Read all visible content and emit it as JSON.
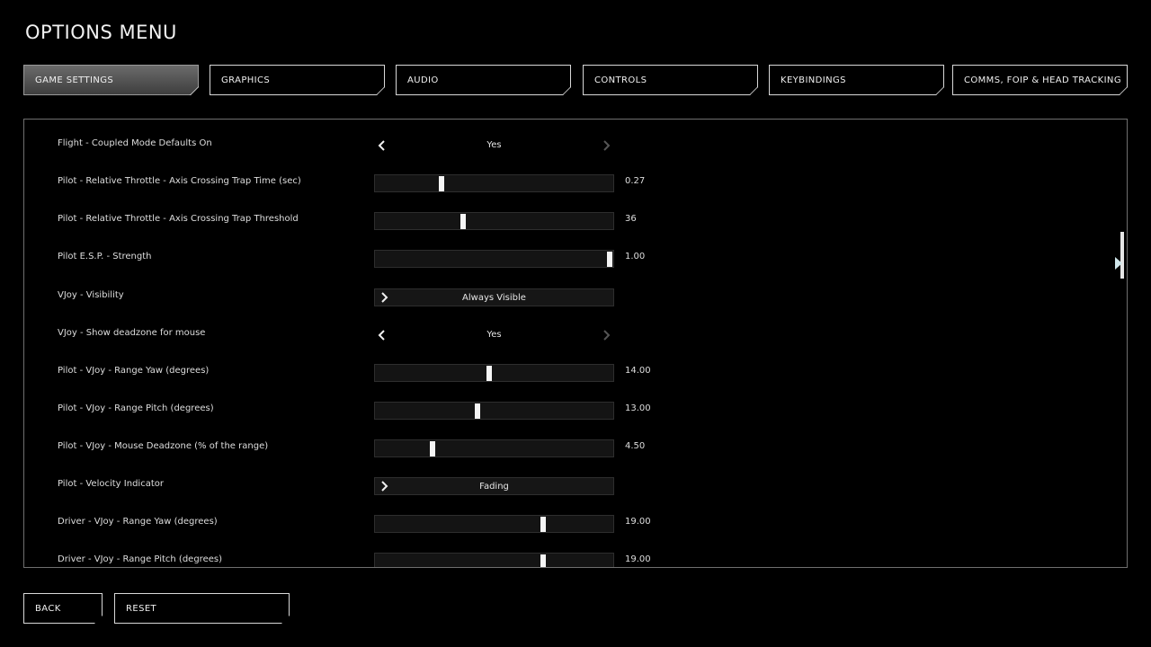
{
  "page": {
    "title": "OPTIONS MENU"
  },
  "tabs": [
    {
      "label": "GAME SETTINGS",
      "active": true
    },
    {
      "label": "GRAPHICS",
      "active": false
    },
    {
      "label": "AUDIO",
      "active": false
    },
    {
      "label": "CONTROLS",
      "active": false
    },
    {
      "label": "KEYBINDINGS",
      "active": false
    },
    {
      "label": "COMMS, FOIP & HEAD TRACKING",
      "active": false
    }
  ],
  "settings": [
    {
      "label": "Flight - Coupled Mode Defaults On",
      "type": "stepper",
      "value": "Yes"
    },
    {
      "label": "Pilot - Relative Throttle - Axis Crossing Trap Time (sec)",
      "type": "slider",
      "value": "0.27",
      "fraction": 0.28
    },
    {
      "label": "Pilot - Relative Throttle - Axis Crossing Trap Threshold",
      "type": "slider",
      "value": "36",
      "fraction": 0.37
    },
    {
      "label": "Pilot E.S.P. - Strength",
      "type": "slider",
      "value": "1.00",
      "fraction": 0.985
    },
    {
      "label": "VJoy - Visibility",
      "type": "select",
      "value": "Always Visible"
    },
    {
      "label": "VJoy - Show deadzone for mouse",
      "type": "stepper",
      "value": "Yes"
    },
    {
      "label": "Pilot - VJoy - Range Yaw (degrees)",
      "type": "slider",
      "value": "14.00",
      "fraction": 0.478
    },
    {
      "label": "Pilot - VJoy - Range Pitch (degrees)",
      "type": "slider",
      "value": "13.00",
      "fraction": 0.43
    },
    {
      "label": "Pilot - VJoy - Mouse Deadzone (% of the range)",
      "type": "slider",
      "value": "4.50",
      "fraction": 0.24
    },
    {
      "label": "Pilot - Velocity Indicator",
      "type": "select",
      "value": "Fading"
    },
    {
      "label": "Driver - VJoy - Range Yaw (degrees)",
      "type": "slider",
      "value": "19.00",
      "fraction": 0.705
    },
    {
      "label": "Driver - VJoy - Range Pitch (degrees)",
      "type": "slider",
      "value": "19.00",
      "fraction": 0.705
    }
  ],
  "footer": {
    "back_label": "BACK",
    "reset_label": "RESET"
  },
  "icons": {
    "prev": "chevron-left-icon",
    "next": "chevron-right-icon",
    "select": "chevron-right-icon"
  },
  "colors": {
    "background": "#000000",
    "text": "#e8e8e8",
    "border": "#d8d8d8",
    "active_tab": "#5a5a5a",
    "slider_track": "#141414",
    "thumb": "#f5f5f5",
    "next_arrow_dim": "#555555"
  }
}
